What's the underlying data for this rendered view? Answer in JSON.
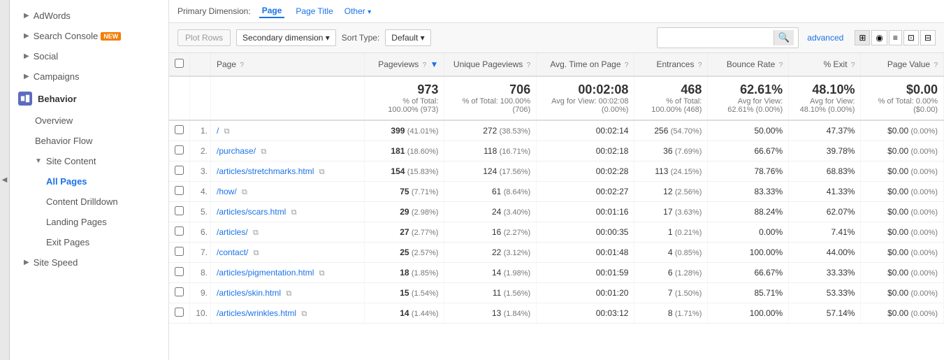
{
  "dimensions": {
    "label": "Primary Dimension:",
    "tabs": [
      "Page",
      "Page Title",
      "Other ▾"
    ]
  },
  "toolbar": {
    "plot_rows": "Plot Rows",
    "secondary_dimension": "Secondary dimension ▾",
    "sort_type_label": "Sort Type:",
    "sort_default": "Default ▾",
    "advanced_label": "advanced",
    "search_placeholder": ""
  },
  "sidebar": {
    "adwords": "AdWords",
    "search_console": "Search Console",
    "new_badge": "NEW",
    "social": "Social",
    "campaigns": "Campaigns",
    "behavior_section": "Behavior",
    "overview": "Overview",
    "behavior_flow": "Behavior Flow",
    "site_content": "Site Content",
    "all_pages": "All Pages",
    "content_drilldown": "Content Drilldown",
    "landing_pages": "Landing Pages",
    "exit_pages": "Exit Pages",
    "site_speed": "Site Speed"
  },
  "table": {
    "headers": {
      "page": "Page",
      "pageviews": "Pageviews",
      "unique_pageviews": "Unique Pageviews",
      "avg_time": "Avg. Time on Page",
      "entrances": "Entrances",
      "bounce_rate": "Bounce Rate",
      "pct_exit": "% Exit",
      "page_value": "Page Value"
    },
    "summary": {
      "pageviews": "973",
      "pageviews_pct": "% of Total: 100.00% (973)",
      "unique_pageviews": "706",
      "unique_pageviews_pct": "% of Total: 100.00% (706)",
      "avg_time": "00:02:08",
      "avg_time_pct": "Avg for View: 00:02:08 (0.00%)",
      "entrances": "468",
      "entrances_pct": "% of Total: 100.00% (468)",
      "bounce_rate": "62.61%",
      "bounce_rate_pct": "Avg for View: 62.61% (0.00%)",
      "pct_exit": "48.10%",
      "pct_exit_pct": "Avg for View: 48.10% (0.00%)",
      "page_value": "$0.00",
      "page_value_pct": "% of Total: 0.00% ($0.00)"
    },
    "rows": [
      {
        "num": "1.",
        "page": "/",
        "pageviews": "399",
        "pv_pct": "(41.01%)",
        "unique": "272",
        "uq_pct": "(38.53%)",
        "avg_time": "00:02:14",
        "entrances": "256",
        "ent_pct": "(54.70%)",
        "bounce": "50.00%",
        "exit": "47.37%",
        "value": "$0.00",
        "val_pct": "(0.00%)"
      },
      {
        "num": "2.",
        "page": "/purchase/",
        "pageviews": "181",
        "pv_pct": "(18.60%)",
        "unique": "118",
        "uq_pct": "(16.71%)",
        "avg_time": "00:02:18",
        "entrances": "36",
        "ent_pct": "(7.69%)",
        "bounce": "66.67%",
        "exit": "39.78%",
        "value": "$0.00",
        "val_pct": "(0.00%)"
      },
      {
        "num": "3.",
        "page": "/articles/stretchmarks.html",
        "pageviews": "154",
        "pv_pct": "(15.83%)",
        "unique": "124",
        "uq_pct": "(17.56%)",
        "avg_time": "00:02:28",
        "entrances": "113",
        "ent_pct": "(24.15%)",
        "bounce": "78.76%",
        "exit": "68.83%",
        "value": "$0.00",
        "val_pct": "(0.00%)"
      },
      {
        "num": "4.",
        "page": "/how/",
        "pageviews": "75",
        "pv_pct": "(7.71%)",
        "unique": "61",
        "uq_pct": "(8.64%)",
        "avg_time": "00:02:27",
        "entrances": "12",
        "ent_pct": "(2.56%)",
        "bounce": "83.33%",
        "exit": "41.33%",
        "value": "$0.00",
        "val_pct": "(0.00%)"
      },
      {
        "num": "5.",
        "page": "/articles/scars.html",
        "pageviews": "29",
        "pv_pct": "(2.98%)",
        "unique": "24",
        "uq_pct": "(3.40%)",
        "avg_time": "00:01:16",
        "entrances": "17",
        "ent_pct": "(3.63%)",
        "bounce": "88.24%",
        "exit": "62.07%",
        "value": "$0.00",
        "val_pct": "(0.00%)"
      },
      {
        "num": "6.",
        "page": "/articles/",
        "pageviews": "27",
        "pv_pct": "(2.77%)",
        "unique": "16",
        "uq_pct": "(2.27%)",
        "avg_time": "00:00:35",
        "entrances": "1",
        "ent_pct": "(0.21%)",
        "bounce": "0.00%",
        "exit": "7.41%",
        "value": "$0.00",
        "val_pct": "(0.00%)"
      },
      {
        "num": "7.",
        "page": "/contact/",
        "pageviews": "25",
        "pv_pct": "(2.57%)",
        "unique": "22",
        "uq_pct": "(3.12%)",
        "avg_time": "00:01:48",
        "entrances": "4",
        "ent_pct": "(0.85%)",
        "bounce": "100.00%",
        "exit": "44.00%",
        "value": "$0.00",
        "val_pct": "(0.00%)"
      },
      {
        "num": "8.",
        "page": "/articles/pigmentation.html",
        "pageviews": "18",
        "pv_pct": "(1.85%)",
        "unique": "14",
        "uq_pct": "(1.98%)",
        "avg_time": "00:01:59",
        "entrances": "6",
        "ent_pct": "(1.28%)",
        "bounce": "66.67%",
        "exit": "33.33%",
        "value": "$0.00",
        "val_pct": "(0.00%)"
      },
      {
        "num": "9.",
        "page": "/articles/skin.html",
        "pageviews": "15",
        "pv_pct": "(1.54%)",
        "unique": "11",
        "uq_pct": "(1.56%)",
        "avg_time": "00:01:20",
        "entrances": "7",
        "ent_pct": "(1.50%)",
        "bounce": "85.71%",
        "exit": "53.33%",
        "value": "$0.00",
        "val_pct": "(0.00%)"
      },
      {
        "num": "10.",
        "page": "/articles/wrinkles.html",
        "pageviews": "14",
        "pv_pct": "(1.44%)",
        "unique": "13",
        "uq_pct": "(1.84%)",
        "avg_time": "00:03:12",
        "entrances": "8",
        "ent_pct": "(1.71%)",
        "bounce": "100.00%",
        "exit": "57.14%",
        "value": "$0.00",
        "val_pct": "(0.00%)"
      }
    ]
  }
}
